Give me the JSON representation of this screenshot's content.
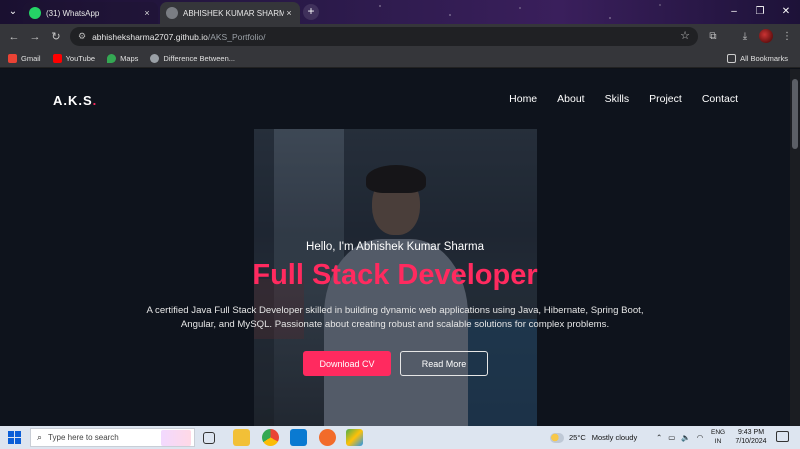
{
  "browser": {
    "tabs": [
      {
        "title": "(31) WhatsApp",
        "icon": "whatsapp-icon",
        "close": "×"
      },
      {
        "title": "ABHISHEK KUMAR SHARMA Portfolio",
        "icon": "globe-icon",
        "close": "×"
      }
    ],
    "new_tab": "+",
    "tab_search": "⌄",
    "window": {
      "minimize": "–",
      "maximize": "❐",
      "close": "✕"
    },
    "nav": {
      "back": "←",
      "forward": "→",
      "reload": "↻"
    },
    "url": {
      "host": "abhisheksharma2707.github.io",
      "path": "/AKS_Portfolio/"
    },
    "bookmark_star": "☆",
    "toolbar_icons": {
      "extensions": "⧉",
      "download": "⤓",
      "menu": "⋮"
    },
    "bookmarks": [
      {
        "label": "Gmail",
        "color": "#ea4335"
      },
      {
        "label": "YouTube",
        "color": "#ff0000"
      },
      {
        "label": "Maps",
        "color": "#34a853"
      },
      {
        "label": "Difference Between...",
        "color": "#9aa0a6"
      }
    ],
    "all_bookmarks": "All Bookmarks"
  },
  "site": {
    "logo": {
      "text": "A.K.S",
      "dot": "."
    },
    "nav": [
      "Home",
      "About",
      "Skills",
      "Project",
      "Contact"
    ],
    "greeting": "Hello, I'm Abhishek Kumar Sharma",
    "role": "Full Stack Developer",
    "description": "A certified Java Full Stack Developer skilled in building dynamic web applications using Java, Hibernate, Spring Boot, Angular, and MySQL. Passionate about creating robust and scalable solutions for complex problems.",
    "buttons": {
      "download_cv": "Download CV",
      "read_more": "Read More"
    },
    "accent": "#ff2a5f"
  },
  "taskbar": {
    "search_placeholder": "Type here to search",
    "weather": {
      "temp": "25°C",
      "desc": "Mostly cloudy"
    },
    "lang": {
      "line1": "ENG",
      "line2": "IN"
    },
    "time": "9:43 PM",
    "date": "7/10/2024",
    "tray_chevron": "⌃"
  }
}
